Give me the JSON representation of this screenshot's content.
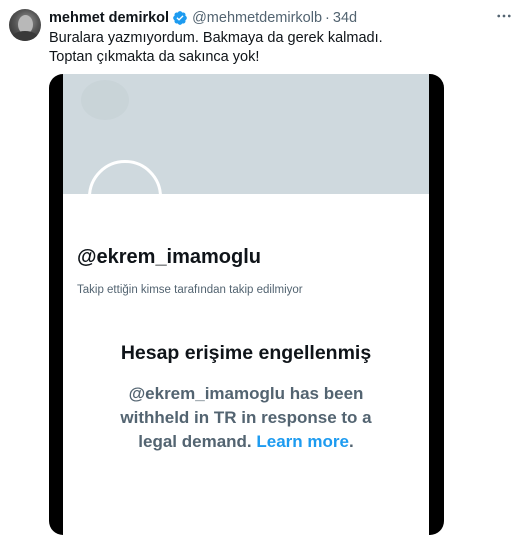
{
  "tweet": {
    "author_name": "mehmet demirkol",
    "handle": "@mehmetdemirkolb",
    "separator": "·",
    "time": "34d",
    "text_line1": "Buralara yazmıyordum. Bakmaya da gerek kalmadı.",
    "text_line2": "Toptan çıkmakta da sakınca yok!",
    "verified_color": "#1d9bf0",
    "icons": {
      "verified": "verified-badge-icon",
      "more": "more-options-icon"
    }
  },
  "media": {
    "screen_name": "@ekrem_imamoglu",
    "follow_note": "Takip ettiğin kimse tarafından takip edilmiyor",
    "blocked_title": "Hesap erişime engellenmiş",
    "blocked_line1": "@ekrem_imamoglu has been",
    "blocked_line2": "withheld in TR in response to a",
    "blocked_line3_text": "legal demand. ",
    "learn_more": "Learn more",
    "period": ".",
    "link_color": "#1d9bf0"
  }
}
